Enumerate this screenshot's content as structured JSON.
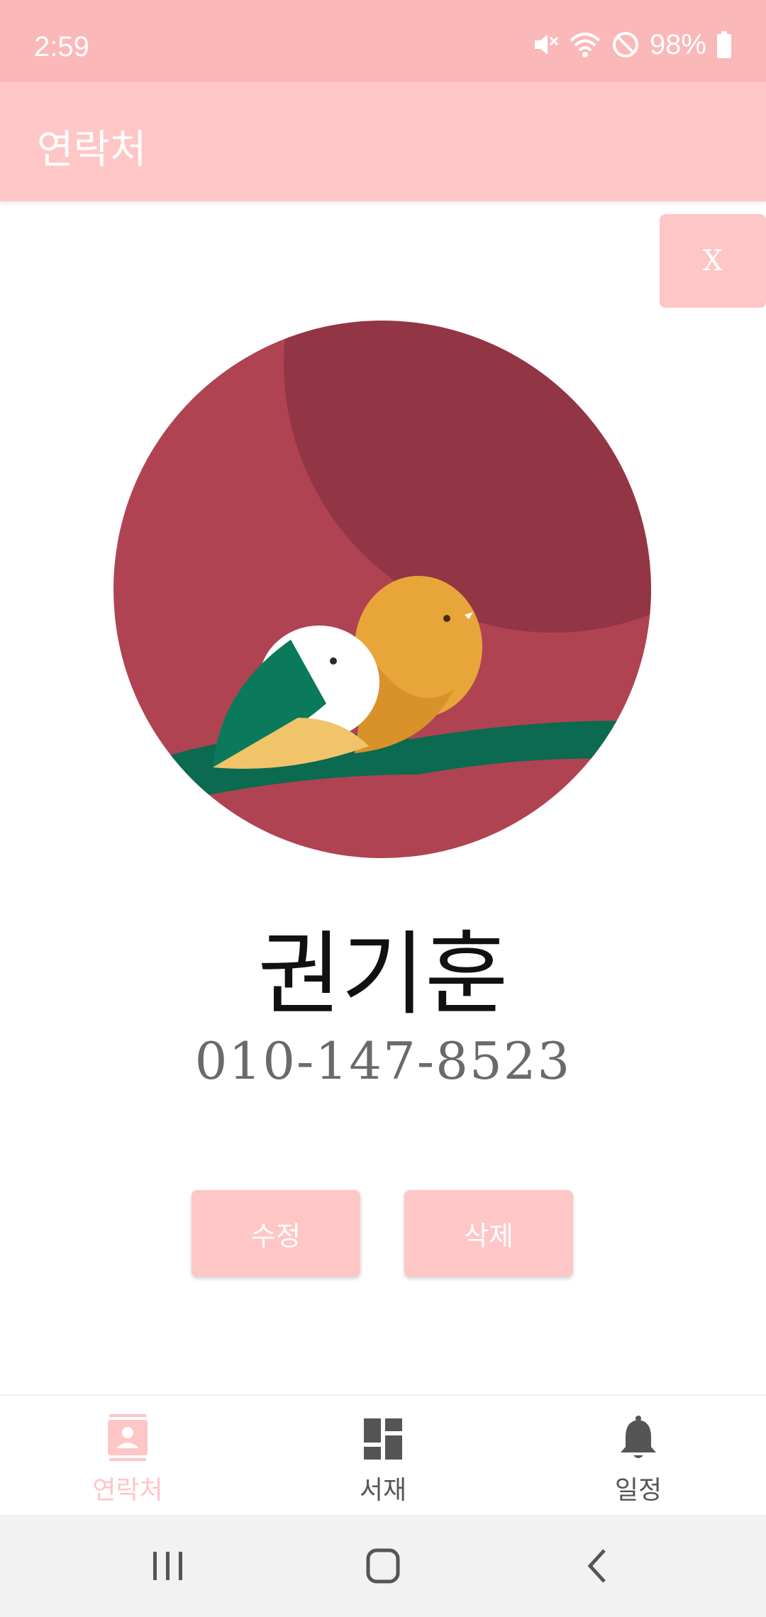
{
  "status_bar": {
    "time": "2:59",
    "battery": "98%",
    "icons": [
      "mute-icon",
      "wifi-icon",
      "do-not-disturb-icon",
      "battery-icon"
    ]
  },
  "app_bar": {
    "title": "연락처"
  },
  "close_button": {
    "label": "X"
  },
  "contact": {
    "name": "권기훈",
    "phone": "010-147-8523",
    "avatar_icon": "birds-on-branch-avatar"
  },
  "actions": {
    "edit_label": "수정",
    "delete_label": "삭제"
  },
  "bottom_nav": {
    "items": [
      {
        "label": "연락처",
        "icon": "contact-card-icon",
        "selected": true
      },
      {
        "label": "서재",
        "icon": "dashboard-icon",
        "selected": false
      },
      {
        "label": "일정",
        "icon": "bell-icon",
        "selected": false
      }
    ]
  },
  "colors": {
    "status_bar": "#fbb8b8",
    "accent": "#ffc6c6",
    "avatar_bg": "#b04352",
    "avatar_shadow": "#923544"
  }
}
